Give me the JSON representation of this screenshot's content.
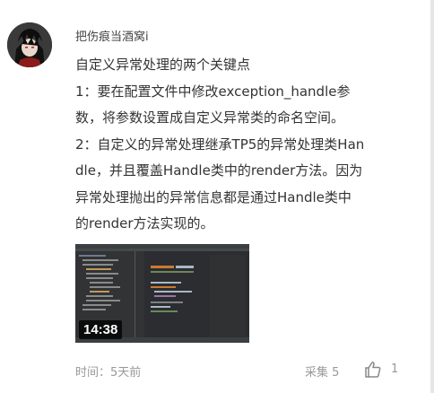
{
  "comment": {
    "username": "把伤痕当酒窝i",
    "lines": [
      "自定义异常处理的两个关键点",
      "1：要在配置文件中修改exception_handle参",
      "数，将参数设置成自定义异常类的命名空间。",
      "2：自定义的异常处理继承TP5的异常处理类Han",
      "dle，并且覆盖Handle类中的render方法。因为",
      "异常处理抛出的异常信息都是通过Handle类中",
      "的render方法实现的。"
    ],
    "video": {
      "duration": "14:38"
    },
    "footer": {
      "time": "时间：5天前",
      "collect": "采集 5",
      "like_count": "1"
    }
  },
  "icons": {
    "like": "thumbs-up-icon"
  },
  "colors": {
    "text": "#333333",
    "meta": "#999999",
    "video_bg": "#2b2d30"
  }
}
